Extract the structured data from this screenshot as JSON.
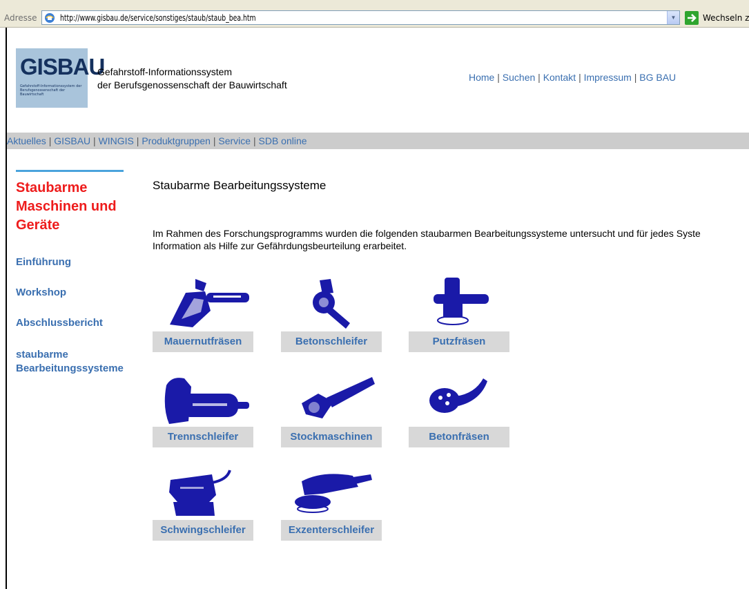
{
  "browser": {
    "address_label": "Adresse",
    "url": "http://www.gisbau.de/service/sonstiges/staub/staub_bea.htm",
    "go_label": "Wechseln z"
  },
  "header": {
    "logo_text": "GISBAU",
    "logo_subtitle": "Gefahrstoff-Informationssystem der Berufsgenossenschaft der Bauwirtschaft",
    "title_line1": "Gefahrstoff-Informationssystem",
    "title_line2": "der Berufsgenossenschaft der Bauwirtschaft",
    "top_nav": [
      "Home",
      "Suchen",
      "Kontakt",
      "Impressum",
      "BG BAU"
    ]
  },
  "main_nav": [
    "Aktuelles",
    "GISBAU",
    "WINGIS",
    "Produktgruppen",
    "Service",
    "SDB online"
  ],
  "sidebar": {
    "heading": "Staubarme Maschinen und Geräte",
    "items": [
      "Einführung",
      "Workshop",
      "Abschlussbericht",
      "staubarme Bearbeitungssysteme"
    ]
  },
  "content": {
    "title": "Staubarme Bearbeitungssysteme",
    "intro_line1": "Im Rahmen des Forschungsprogramms wurden die folgenden staubarmen Bearbeitungssysteme untersucht und für jedes Syste",
    "intro_line2": "Information als Hilfe zur Gefährdungsbeurteilung erarbeitet.",
    "tools": [
      "Mauernutfräsen",
      "Betonschleifer",
      "Putzfräsen",
      "Trennschleifer",
      "Stockmaschinen",
      "Betonfräsen",
      "Schwingschleifer",
      "Exzenterschleifer"
    ]
  },
  "colors": {
    "link": "#3a6fb0",
    "heading_red": "#ee1c1c",
    "tool_blue": "#1a1aa8",
    "nav_bar": "#cccccc",
    "label_bg": "#d8d8d8"
  }
}
